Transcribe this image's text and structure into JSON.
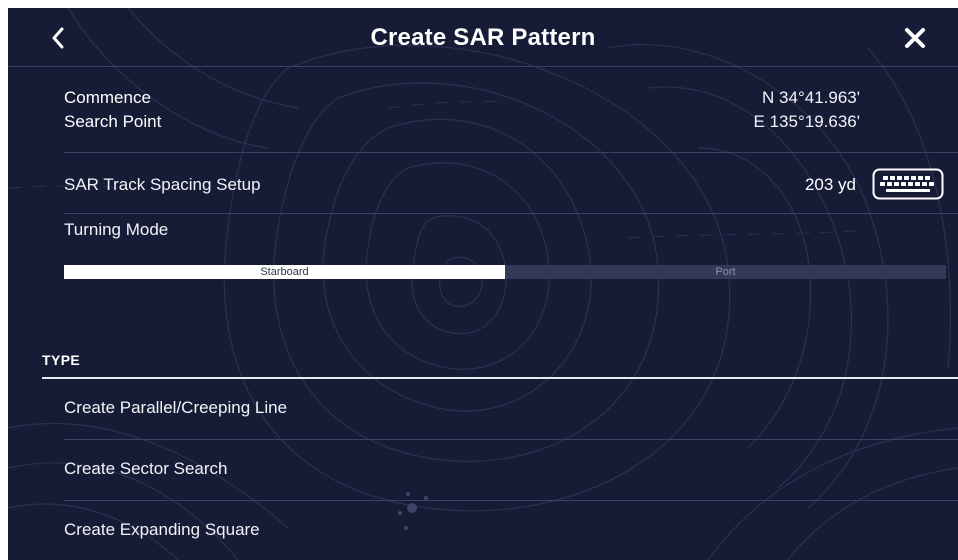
{
  "header": {
    "title": "Create SAR Pattern",
    "back_icon": "chevron-left-icon",
    "close_icon": "close-icon"
  },
  "commence": {
    "label_line1": "Commence",
    "label_line2": "Search Point",
    "lat": "N 34°41.963'",
    "lon": "E 135°19.636'"
  },
  "spacing": {
    "label": "SAR Track Spacing Setup",
    "value": "203 yd",
    "keyboard_icon": "keyboard-icon"
  },
  "turning": {
    "label": "Turning Mode",
    "options": [
      "Starboard",
      "Port"
    ],
    "selected": "Starboard"
  },
  "type_section": {
    "header": "TYPE",
    "items": [
      "Create Parallel/Creeping Line",
      "Create Sector Search",
      "Create Expanding Square"
    ]
  },
  "colors": {
    "background": "#171c36",
    "divider": "#3b4163",
    "text": "#f2f3f8",
    "segment_active": "#ffffff",
    "segment_inactive": "#333a55"
  }
}
